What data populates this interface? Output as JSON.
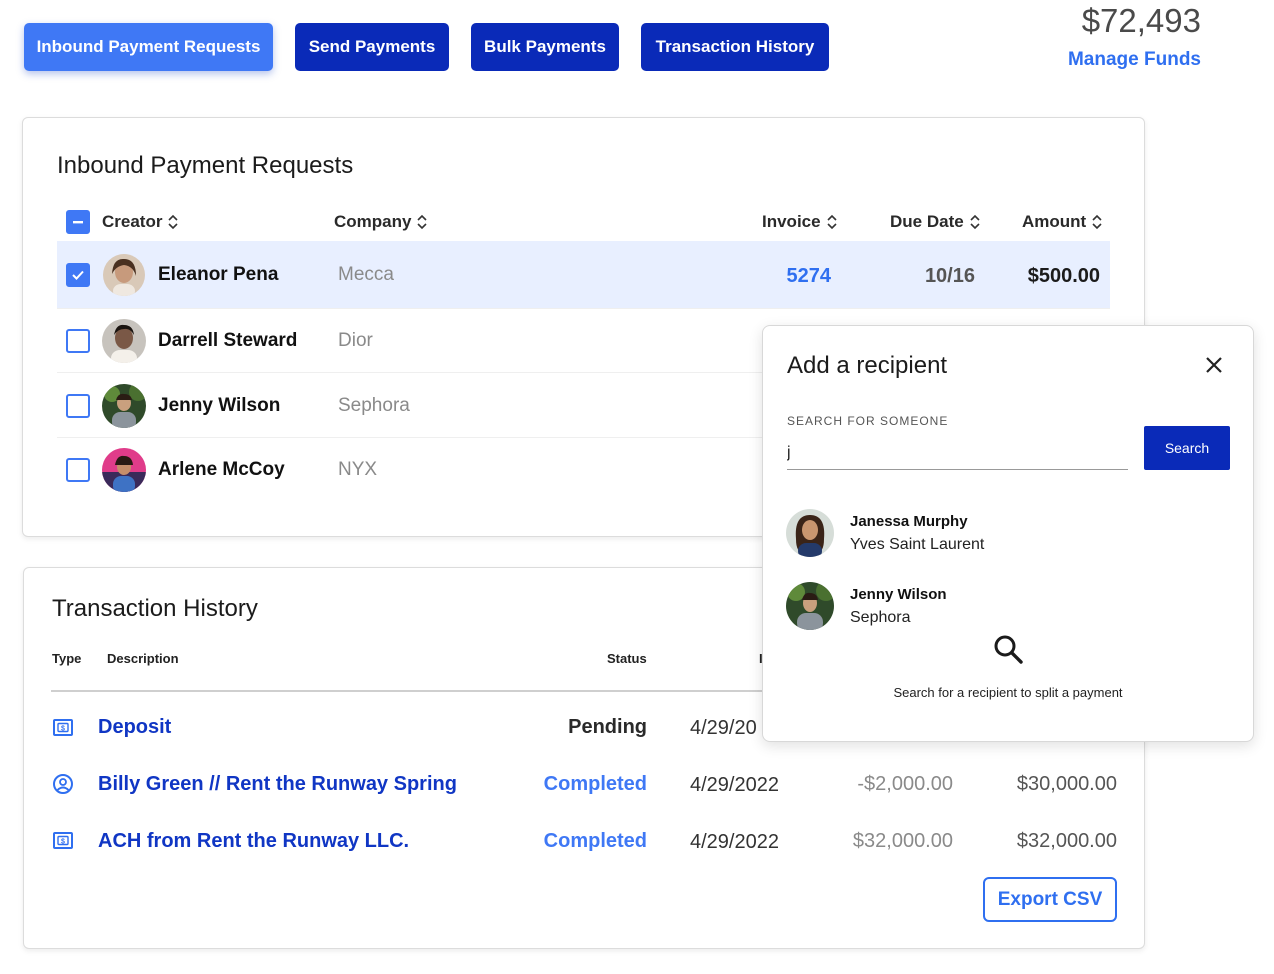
{
  "nav": {
    "tabs": [
      {
        "label": "Inbound Payment Requests",
        "active": true
      },
      {
        "label": "Send Payments",
        "active": false
      },
      {
        "label": "Bulk Payments",
        "active": false
      },
      {
        "label": "Transaction History",
        "active": false
      }
    ],
    "balance": "$72,493",
    "manage_funds": "Manage Funds"
  },
  "inbound": {
    "title": "Inbound Payment Requests",
    "columns": {
      "creator": "Creator",
      "company": "Company",
      "invoice": "Invoice",
      "due_date": "Due Date",
      "amount": "Amount"
    },
    "rows": [
      {
        "name": "Eleanor Pena",
        "company": "Mecca",
        "invoice": "5274",
        "due": "10/16",
        "amount": "$500.00",
        "checked": true
      },
      {
        "name": "Darrell Steward",
        "company": "Dior",
        "checked": false
      },
      {
        "name": "Jenny Wilson",
        "company": "Sephora",
        "checked": false
      },
      {
        "name": "Arlene McCoy",
        "company": "NYX",
        "checked": false
      }
    ]
  },
  "transactions": {
    "title": "Transaction History",
    "columns": {
      "type": "Type",
      "description": "Description",
      "status": "Status",
      "date_partial": "I"
    },
    "rows": [
      {
        "icon": "dollar-bill-icon",
        "description": "Deposit",
        "status": "Pending",
        "date": "4/29/20"
      },
      {
        "icon": "user-circle-icon",
        "description": "Billy Green // Rent the Runway Spring",
        "status": "Completed",
        "date": "4/29/2022",
        "change": "-$2,000.00",
        "balance": "$30,000.00"
      },
      {
        "icon": "dollar-bill-icon",
        "description": "ACH from Rent the Runway LLC.",
        "status": "Completed",
        "date": "4/29/2022",
        "change": "$32,000.00",
        "balance": "$32,000.00"
      }
    ],
    "export_label": "Export CSV"
  },
  "modal": {
    "title": "Add a recipient",
    "search_label": "SEARCH FOR SOMEONE",
    "search_value": "j",
    "search_button": "Search",
    "results": [
      {
        "name": "Janessa Murphy",
        "company": "Yves Saint Laurent"
      },
      {
        "name": "Jenny Wilson",
        "company": "Sephora"
      }
    ],
    "hint": "Search for a recipient to split a payment"
  },
  "colors": {
    "primary": "#0a2ab8",
    "accent": "#3f78f5",
    "link": "#2f6ff0",
    "selected_row": "#e8efff"
  }
}
